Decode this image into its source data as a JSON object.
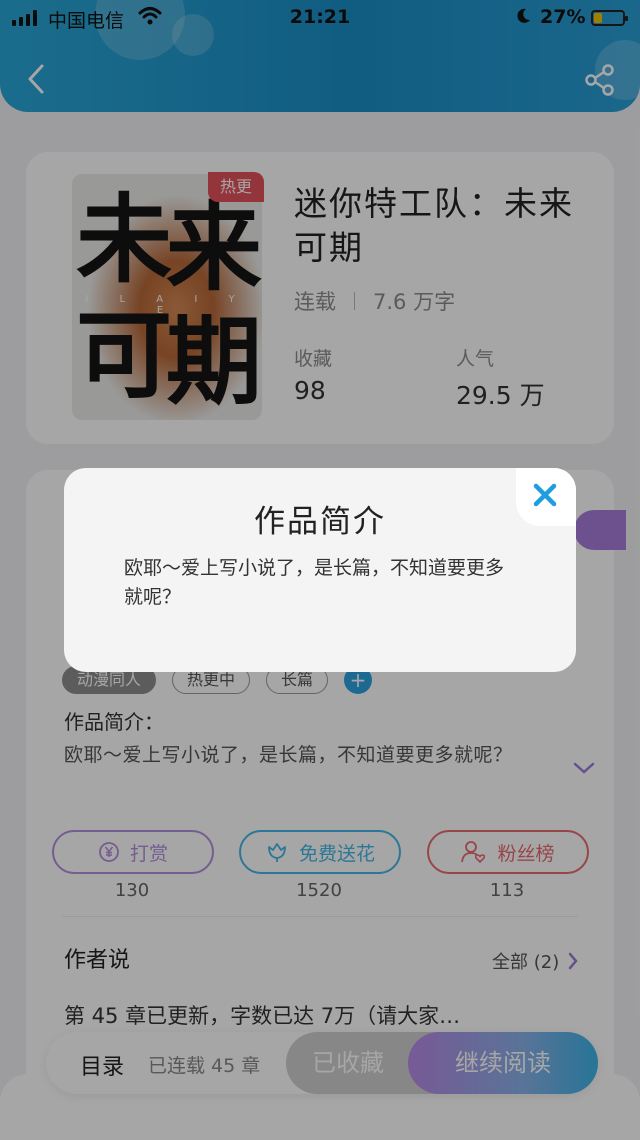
{
  "status_bar": {
    "carrier": "中国电信",
    "time": "21:21",
    "battery_percent": "27%",
    "battery_level": 0.27
  },
  "nav": {
    "back_icon": "chevron-left-icon",
    "share_icon": "share-icon"
  },
  "book": {
    "cover_text": "未来可期",
    "cover_subtitle": "I L A I Y E",
    "hot_badge": "热更",
    "title": "迷你特工队：未来可期",
    "status": "连载",
    "word_count": "7.6 万字",
    "favorites_label": "收藏",
    "favorites_value": "98",
    "popularity_label": "人气",
    "popularity_value": "29.5 万"
  },
  "details": {
    "tags": [
      "动漫同人",
      "热更中",
      "长篇"
    ],
    "intro_heading": "作品简介：",
    "intro_text": "欧耶～爱上写小说了，是长篇，不知道要更多就呢？",
    "actions": [
      {
        "label": "打赏",
        "count": "130",
        "icon": "yen-coin-icon",
        "color": "#b48ee0"
      },
      {
        "label": "免费送花",
        "count": "1520",
        "icon": "flower-icon",
        "color": "#45b7e6"
      },
      {
        "label": "粉丝榜",
        "count": "113",
        "icon": "fan-user-heart-icon",
        "color": "#ea6b72"
      }
    ],
    "author_says_title": "作者说",
    "author_all": "全部 (2)",
    "author_preview": "第 45 章已更新，字数已达 7万（请大家…"
  },
  "bottom_bar": {
    "toc_label": "目录",
    "toc_count": "已连载 45 章",
    "collected_label": "已收藏",
    "continue_label": "继续阅读"
  },
  "modal": {
    "title": "作品简介",
    "body": "欧耶～爱上写小说了，是长篇，不知道要更多就呢？",
    "close_icon": "close-icon"
  },
  "colors": {
    "header": "#1a8fc7",
    "hot_badge": "#e4525c",
    "close_x": "#1e9ee0"
  }
}
